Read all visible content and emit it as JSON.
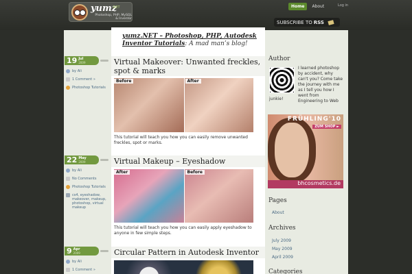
{
  "header": {
    "logo_title": "yumz",
    "logo_tld": ".NET",
    "logo_subtitle": "Photoshop, PHP, MySQL & Inventor",
    "nav": [
      {
        "label": "Home"
      },
      {
        "label": "About"
      }
    ],
    "login": "Log in",
    "rss": {
      "prefix": "SUBSCRIBE TO",
      "label": "RSS"
    }
  },
  "intro": {
    "blog_name": "yumz.NET – Photoshop, PHP, Autodesk Inventor Tutorials",
    "tagline": ": A mad man’s blog!"
  },
  "posts": [
    {
      "day": "19",
      "month": "Jul",
      "year": "2009",
      "title": "Virtual Makeover: Unwanted freckles, spot & marks",
      "image_labels": {
        "left": "Before",
        "right": "After"
      },
      "excerpt": "This tutorial will teach you how you can easily remove unwanted freckles, spot or marks.",
      "author": "by Ali",
      "comments": "1 Comment »",
      "category": "Photoshop Tutorials"
    },
    {
      "day": "22",
      "month": "May",
      "year": "2009",
      "title": "Virtual Makeup – Eyeshadow",
      "image_labels": {
        "left": "After",
        "right": "Before"
      },
      "excerpt": "This tutorial will teach you how you can easily apply eyeshadow to anyone in few simple steps.",
      "author": "by Ali",
      "comments": "No Comments",
      "category": "Photoshop Tutorials",
      "tags": "cs4, eyeshadow, makeover, makeup, photoshop, virtual makeup"
    },
    {
      "day": "9",
      "month": "Apr",
      "year": "2009",
      "title": "Circular Pattern in Autodesk Inventor",
      "author": "by Ali",
      "comments": "1 Comment »"
    }
  ],
  "sidebar": {
    "author_title": "Author",
    "author_text": "I learned photoshop by accident, why can't you? Come take the journey with me as I tell you how I went from Engineering to Web",
    "author_text_2": "junkie!",
    "ad": {
      "title": "FRÜHLING'10",
      "shop": "ZUM SHOP ►",
      "brand": "bhcosmetics.de"
    },
    "pages_title": "Pages",
    "pages": [
      {
        "label": "About"
      }
    ],
    "archives_title": "Archives",
    "archives": [
      {
        "label": "July 2009"
      },
      {
        "label": "May 2009"
      },
      {
        "label": "April 2009"
      }
    ],
    "categories_title": "Categories"
  }
}
